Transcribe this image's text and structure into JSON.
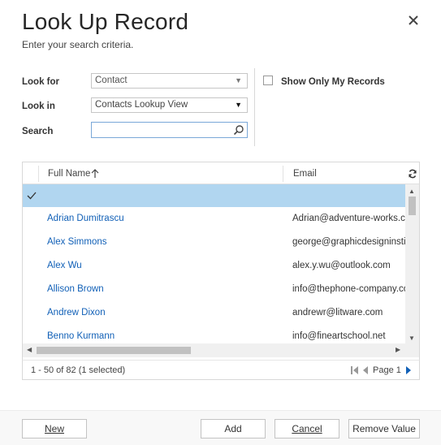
{
  "dialog": {
    "title": "Look Up Record",
    "subtitle": "Enter your search criteria.",
    "close_icon": "close-icon"
  },
  "form": {
    "look_for_label": "Look for",
    "look_for_value": "Contact",
    "look_in_label": "Look in",
    "look_in_value": "Contacts Lookup View",
    "search_label": "Search",
    "search_value": "",
    "show_only_my_records_label": "Show Only My Records",
    "show_only_my_records_checked": false
  },
  "grid": {
    "columns": {
      "full_name": "Full Name",
      "email": "Email"
    },
    "sort_icon": "sort-ascending-icon",
    "refresh_icon": "refresh-icon",
    "selected_row_icon": "checkmark-icon",
    "rows": [
      {
        "name": "Adrian Dumitrascu",
        "email": "Adrian@adventure-works.com"
      },
      {
        "name": "Alex Simmons",
        "email": "george@graphicdesigninstitute.com"
      },
      {
        "name": "Alex Wu",
        "email": "alex.y.wu@outlook.com"
      },
      {
        "name": "Allison Brown",
        "email": "info@thephone-company.com"
      },
      {
        "name": "Andrew Dixon",
        "email": "andrewr@litware.com"
      },
      {
        "name": "Benno Kurmann",
        "email": "info@fineartschool.net"
      }
    ]
  },
  "footer": {
    "record_count": "1 - 50 of 82 (1 selected)",
    "page_label": "Page 1"
  },
  "buttons": {
    "new_label": "New",
    "add_label": "Add",
    "cancel_label": "Cancel",
    "remove_value_label": "Remove Value"
  },
  "colors": {
    "selected_row": "#b1d6f0",
    "link": "#1160b7",
    "pager_next": "#1160b7"
  }
}
